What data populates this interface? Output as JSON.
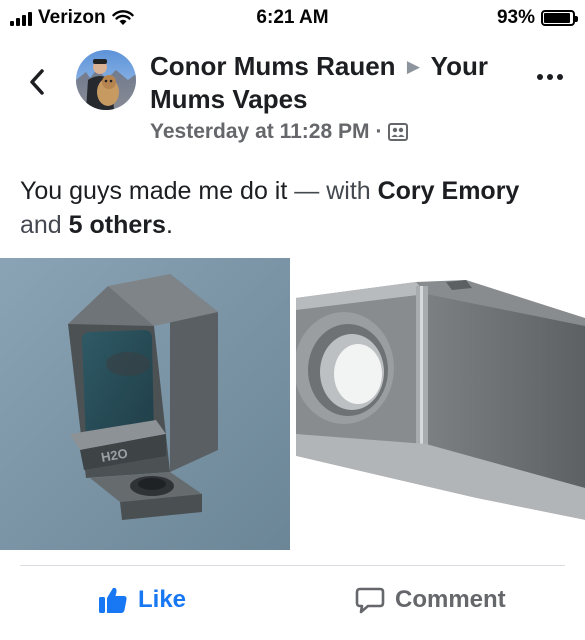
{
  "status_bar": {
    "carrier": "Verizon",
    "time": "6:21 AM",
    "battery_percent": "93%",
    "battery_level": 0.93,
    "icons": [
      "signal-icon",
      "wifi-icon",
      "battery-icon"
    ]
  },
  "post": {
    "author": "Conor Mums Rauen",
    "group": "Your Mums Vapes",
    "timestamp": "Yesterday at 11:28 PM",
    "separator": "·",
    "text_main": "You guys made me do it",
    "text_dash": " — with ",
    "tag_1": "Cory Emory",
    "text_and": " and ",
    "tag_2": "5 others",
    "text_end": "."
  },
  "actions": {
    "like_label": "Like",
    "comment_label": "Comment"
  },
  "colors": {
    "accent": "#1877f2",
    "secondary_text": "#65676b",
    "primary_text": "#1c1e21",
    "divider": "#dadde1"
  }
}
